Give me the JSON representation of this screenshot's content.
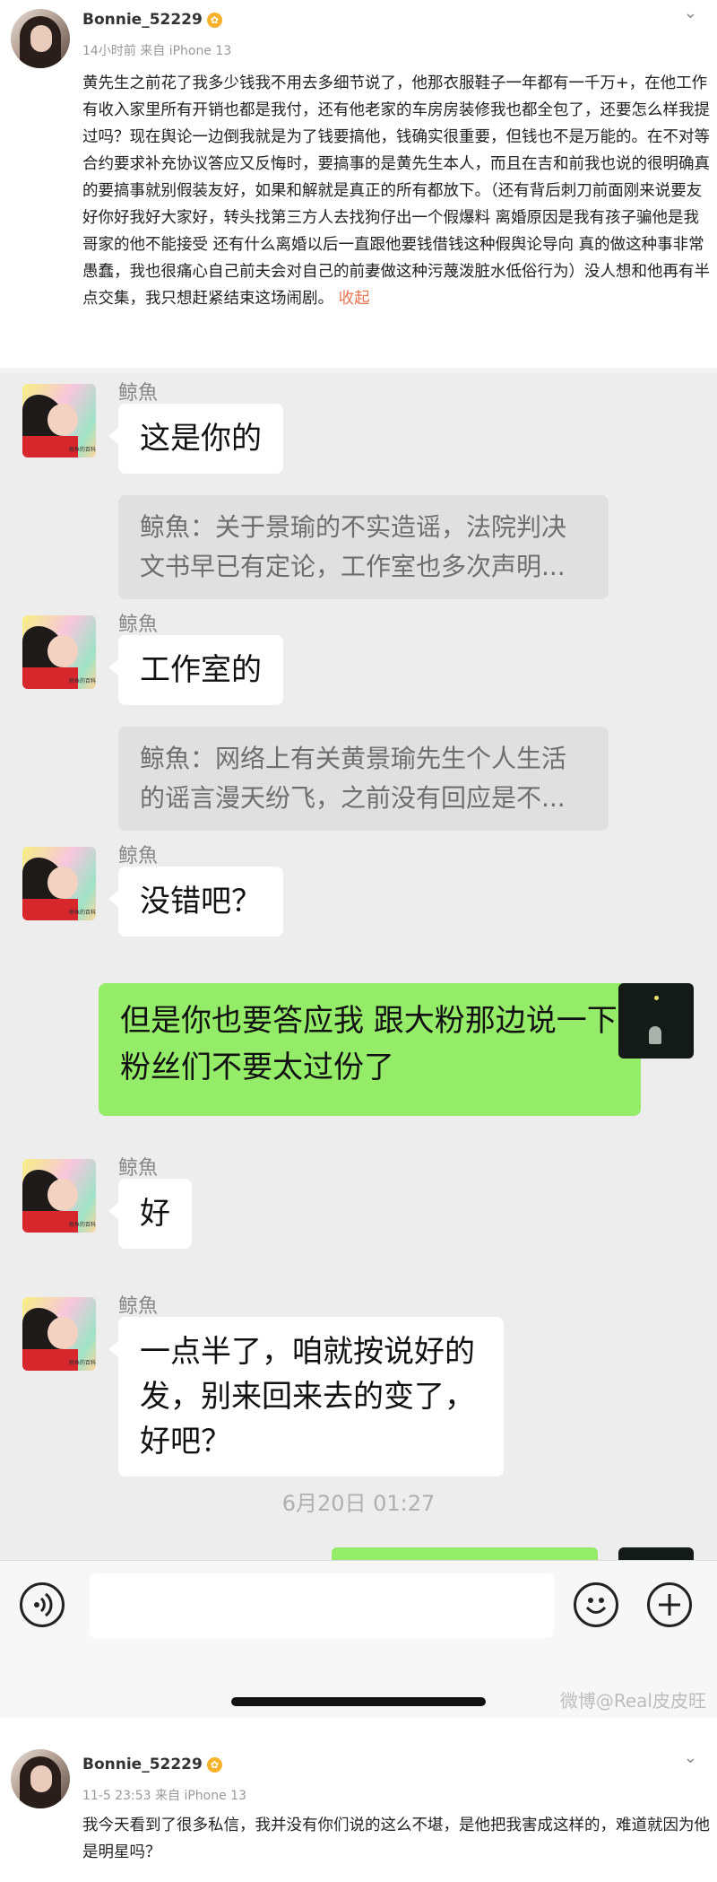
{
  "post1": {
    "username": "Bonnie_52229",
    "vip_badge": "✿",
    "meta": "14小时前  来自 iPhone 13",
    "body": "黄先生之前花了我多少钱我不用去多细节说了，他那衣服鞋子一年都有一千万+，在他工作有收入家里所有开销也都是我付，还有他老家的车房房装修我也都全包了，还要怎么样我提过吗？现在舆论一边倒我就是为了钱要搞他，钱确实很重要，但钱也不是万能的。在不对等合约要求补充协议答应又反悔时，要搞事的是黄先生本人，而且在吉和前我也说的很明确真的要搞事就别假装友好，如果和解就是真正的所有都放下。（还有背后刺刀前面刚来说要友好你好我好大家好，转头找第三方人去找狗仔出一个假爆料 离婚原因是我有孩子骗他是我哥家的他不能接受 还有什么离婚以后一直跟他要钱借钱这种假舆论导向 真的做这种事非常愚蠢，我也很痛心自己前夫会对自己的前妻做这种污蔑泼脏水低俗行为）没人想和他再有半点交集，我只想赶紧结束这场闹剧。",
    "collapse": "收起"
  },
  "chat": {
    "messages": [
      {
        "sender": "鲸魚",
        "text": "这是你的",
        "quote": "鲸魚：关于景瑜的不实造谣，法院判决文书早已有定论，工作室也多次声明..."
      },
      {
        "sender": "鲸魚",
        "text": "工作室的",
        "quote": "鲸魚：网络上有关黄景瑜先生个人生活的谣言漫天纷飞，之前没有回应是不..."
      },
      {
        "sender": "鲸魚",
        "text": "没错吧？"
      },
      {
        "sender": "鲸魚",
        "text": "好"
      },
      {
        "sender": "鲸魚",
        "text": "一点半了，咱就按说好的发，别来回来去的变了，好吧？"
      }
    ],
    "my_message": "但是你也要答应我 跟大粉那边说一下粉丝们不要太过份了",
    "avatar_caption": "鲸鱼的百科",
    "timestamp": "6月20日 01:27",
    "input_placeholder": "",
    "voice_icon": "voice-icon",
    "emoji_icon": "emoji-icon",
    "plus_icon": "plus-icon",
    "watermark": "微博@Real皮皮旺"
  },
  "post2": {
    "username": "Bonnie_52229",
    "vip_badge": "✿",
    "meta": "11-5 23:53  来自 iPhone 13",
    "body": "我今天看到了很多私信，我并没有你们说的这么不堪，是他把我害成这样的，难道就因为他是明星吗？"
  },
  "colors": {
    "chat_bg": "#ededed",
    "my_bubble": "#95ec69",
    "collapse_link": "#eb7350"
  }
}
